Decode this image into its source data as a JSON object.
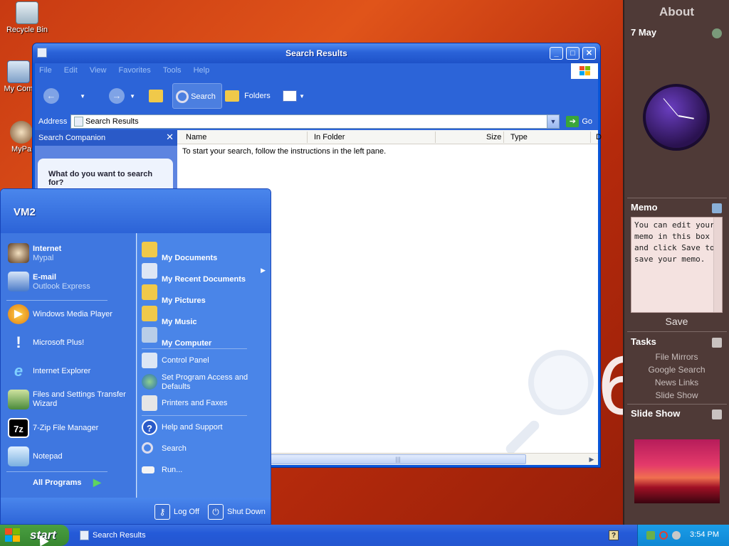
{
  "desktop": {
    "icons": [
      {
        "label": "Recycle Bin"
      },
      {
        "label": "My Com"
      },
      {
        "label": "MyPa"
      }
    ],
    "bg_glyph": "6"
  },
  "window": {
    "title": "Search Results",
    "menu": [
      "File",
      "Edit",
      "View",
      "Favorites",
      "Tools",
      "Help"
    ],
    "toolbar": {
      "search": "Search",
      "folders": "Folders"
    },
    "address": {
      "label": "Address",
      "value": "Search Results",
      "go": "Go"
    },
    "companion": {
      "header": "Search Companion",
      "question": "What do you want to search for?"
    },
    "columns": [
      "Name",
      "In Folder",
      "Size",
      "Type",
      "D"
    ],
    "message": "To start your search, follow the instructions in the left pane."
  },
  "startmenu": {
    "user": "VM2",
    "pinned": [
      {
        "title": "Internet",
        "subtitle": "Mypal"
      },
      {
        "title": "E-mail",
        "subtitle": "Outlook Express"
      }
    ],
    "recent": [
      "Windows Media Player",
      "Microsoft Plus!",
      "Internet Explorer",
      "Files and Settings Transfer Wizard",
      "7-Zip File Manager",
      "Notepad"
    ],
    "all_programs": "All Programs",
    "right": [
      "My Documents",
      "My Recent Documents",
      "My Pictures",
      "My Music",
      "My Computer",
      "Control Panel",
      "Set Program Access and Defaults",
      "Printers and Faxes",
      "Help and Support",
      "Search",
      "Run..."
    ],
    "footer": {
      "logoff": "Log Off",
      "shutdown": "Shut Down"
    }
  },
  "sidebar": {
    "title": "About",
    "date": "7 May",
    "memo_title": "Memo",
    "memo_text": "You can edit your memo in this box and click Save to save your memo.",
    "save": "Save",
    "tasks_title": "Tasks",
    "tasks": [
      "File Mirrors",
      "Google Search",
      "News Links",
      "Slide Show"
    ],
    "slideshow_title": "Slide Show"
  },
  "taskbar": {
    "start": "start",
    "task": "Search Results",
    "help": "?",
    "time": "3:54 PM"
  }
}
